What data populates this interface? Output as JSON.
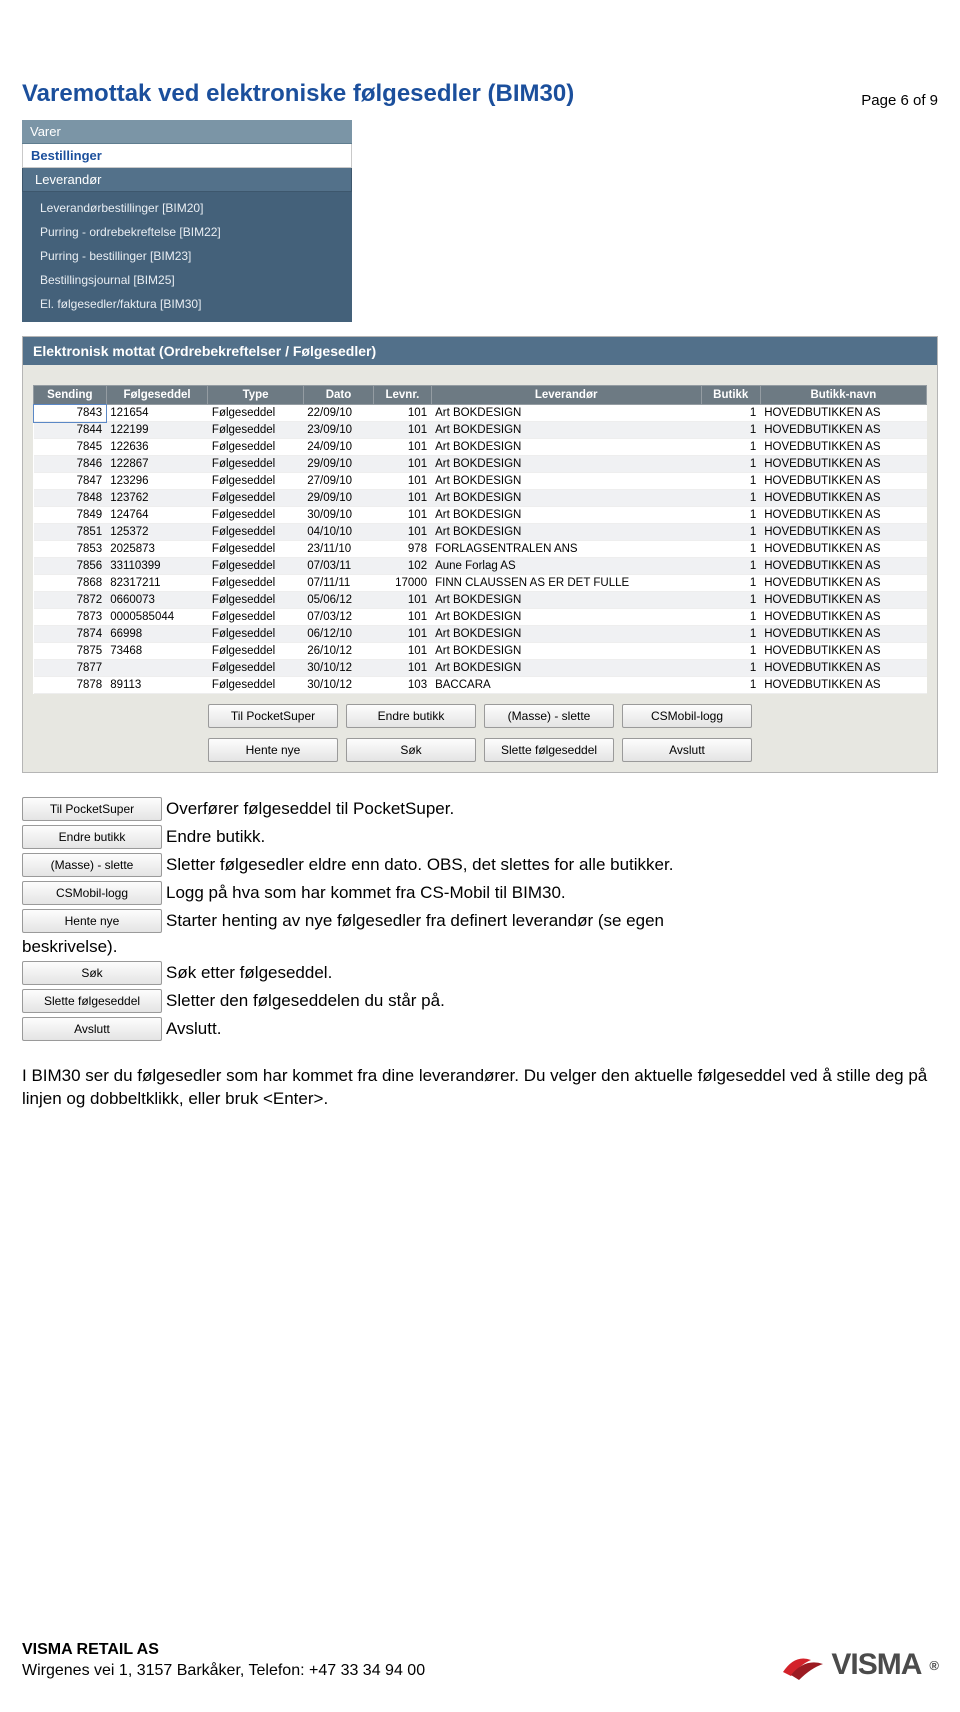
{
  "page_label": "Page 6 of 9",
  "heading": "Varemottak ved elektroniske følgesedler (BIM30)",
  "sidebar": {
    "varer": "Varer",
    "bestillinger": "Bestillinger",
    "leverandor": "Leverandør",
    "items": [
      "Leverandørbestillinger [BIM20]",
      "Purring - ordrebekreftelse [BIM22]",
      "Purring - bestillinger [BIM23]",
      "Bestillingsjournal [BIM25]",
      "El. følgesedler/faktura [BIM30]"
    ]
  },
  "panel": {
    "title": "Elektronisk mottat (Ordrebekreftelser / Følgesedler)",
    "columns": [
      "Sending",
      "Følgeseddel",
      "Type",
      "Dato",
      "Levnr.",
      "Leverandør",
      "Butikk",
      "Butikk-navn"
    ],
    "rows": [
      [
        "7843",
        "121654",
        "Følgeseddel",
        "22/09/10",
        "101",
        "Art BOKDESIGN",
        "1",
        "HOVEDBUTIKKEN AS"
      ],
      [
        "7844",
        "122199",
        "Følgeseddel",
        "23/09/10",
        "101",
        "Art BOKDESIGN",
        "1",
        "HOVEDBUTIKKEN AS"
      ],
      [
        "7845",
        "122636",
        "Følgeseddel",
        "24/09/10",
        "101",
        "Art BOKDESIGN",
        "1",
        "HOVEDBUTIKKEN AS"
      ],
      [
        "7846",
        "122867",
        "Følgeseddel",
        "29/09/10",
        "101",
        "Art BOKDESIGN",
        "1",
        "HOVEDBUTIKKEN AS"
      ],
      [
        "7847",
        "123296",
        "Følgeseddel",
        "27/09/10",
        "101",
        "Art BOKDESIGN",
        "1",
        "HOVEDBUTIKKEN AS"
      ],
      [
        "7848",
        "123762",
        "Følgeseddel",
        "29/09/10",
        "101",
        "Art BOKDESIGN",
        "1",
        "HOVEDBUTIKKEN AS"
      ],
      [
        "7849",
        "124764",
        "Følgeseddel",
        "30/09/10",
        "101",
        "Art BOKDESIGN",
        "1",
        "HOVEDBUTIKKEN AS"
      ],
      [
        "7851",
        "125372",
        "Følgeseddel",
        "04/10/10",
        "101",
        "Art BOKDESIGN",
        "1",
        "HOVEDBUTIKKEN AS"
      ],
      [
        "7853",
        "2025873",
        "Følgeseddel",
        "23/11/10",
        "978",
        "FORLAGSENTRALEN ANS",
        "1",
        "HOVEDBUTIKKEN AS"
      ],
      [
        "7856",
        "33110399",
        "Følgeseddel",
        "07/03/11",
        "102",
        "Aune Forlag AS",
        "1",
        "HOVEDBUTIKKEN AS"
      ],
      [
        "7868",
        "82317211",
        "Følgeseddel",
        "07/11/11",
        "17000",
        "FINN CLAUSSEN AS ER DET FULLE",
        "1",
        "HOVEDBUTIKKEN AS"
      ],
      [
        "7872",
        "0660073",
        "Følgeseddel",
        "05/06/12",
        "101",
        "Art BOKDESIGN",
        "1",
        "HOVEDBUTIKKEN AS"
      ],
      [
        "7873",
        "0000585044",
        "Følgeseddel",
        "07/03/12",
        "101",
        "Art BOKDESIGN",
        "1",
        "HOVEDBUTIKKEN AS"
      ],
      [
        "7874",
        "66998",
        "Følgeseddel",
        "06/12/10",
        "101",
        "Art BOKDESIGN",
        "1",
        "HOVEDBUTIKKEN AS"
      ],
      [
        "7875",
        "73468",
        "Følgeseddel",
        "26/10/12",
        "101",
        "Art BOKDESIGN",
        "1",
        "HOVEDBUTIKKEN AS"
      ],
      [
        "7877",
        "",
        "Følgeseddel",
        "30/10/12",
        "101",
        "Art BOKDESIGN",
        "1",
        "HOVEDBUTIKKEN AS"
      ],
      [
        "7878",
        "89113",
        "Følgeseddel",
        "30/10/12",
        "103",
        "BACCARA",
        "1",
        "HOVEDBUTIKKEN AS"
      ]
    ],
    "buttons_row1": [
      "Til PocketSuper",
      "Endre butikk",
      "(Masse) - slette",
      "CSMobil-logg"
    ],
    "buttons_row2": [
      "Hente nye",
      "Søk",
      "Slette følgeseddel",
      "Avslutt"
    ]
  },
  "descriptions": {
    "items": [
      {
        "btn": "Til PocketSuper",
        "text": "Overfører følgeseddel til PocketSuper."
      },
      {
        "btn": "Endre butikk",
        "text": " Endre butikk."
      },
      {
        "btn": "(Masse) - slette",
        "text": " Sletter følgesedler eldre enn dato. OBS, det slettes for alle butikker."
      },
      {
        "btn": "CSMobil-logg",
        "text": " Logg på hva som har kommet fra CS-Mobil til BIM30."
      },
      {
        "btn": "Hente nye",
        "text": " Starter henting av nye følgesedler fra definert leverandør (se egen"
      }
    ],
    "cont": "beskrivelse).",
    "items2": [
      {
        "btn": "Søk",
        "text": " Søk etter følgeseddel."
      },
      {
        "btn": "Slette følgeseddel",
        "text": " Sletter den følgeseddelen du står på."
      },
      {
        "btn": "Avslutt",
        "text": " Avslutt."
      }
    ]
  },
  "body_text": "I BIM30 ser du følgesedler som har kommet fra dine leverandører. Du velger den aktuelle følgeseddel ved å stille deg på linjen og dobbeltklikk, eller bruk <Enter>.",
  "footer": {
    "company": "VISMA RETAIL AS",
    "address": "Wirgenes vei 1, 3157 Barkåker, Telefon: +47 33 34 94 00",
    "logo_text": "VISMA"
  }
}
